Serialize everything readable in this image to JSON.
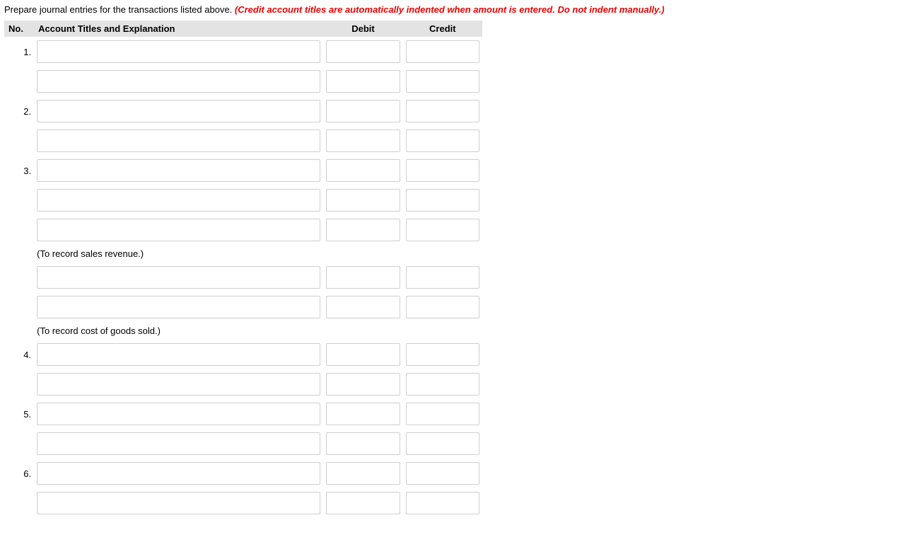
{
  "prompt": {
    "main": "Prepare journal entries for the transactions listed above. ",
    "note": "(Credit account titles are automatically indented when amount is entered. Do not indent manually.)"
  },
  "headers": {
    "no": "No.",
    "title": "Account Titles and Explanation",
    "debit": "Debit",
    "credit": "Credit"
  },
  "rows": [
    {
      "no": "1.",
      "type": "input"
    },
    {
      "no": "",
      "type": "input"
    },
    {
      "no": "2.",
      "type": "input"
    },
    {
      "no": "",
      "type": "input"
    },
    {
      "no": "3.",
      "type": "input"
    },
    {
      "no": "",
      "type": "input"
    },
    {
      "no": "",
      "type": "input"
    },
    {
      "no": "",
      "type": "explain",
      "text": "(To record sales revenue.)"
    },
    {
      "no": "",
      "type": "input"
    },
    {
      "no": "",
      "type": "input"
    },
    {
      "no": "",
      "type": "explain",
      "text": "(To record cost of goods sold.)"
    },
    {
      "no": "4.",
      "type": "input"
    },
    {
      "no": "",
      "type": "input"
    },
    {
      "no": "5.",
      "type": "input"
    },
    {
      "no": "",
      "type": "input"
    },
    {
      "no": "6.",
      "type": "input"
    },
    {
      "no": "",
      "type": "input"
    }
  ]
}
